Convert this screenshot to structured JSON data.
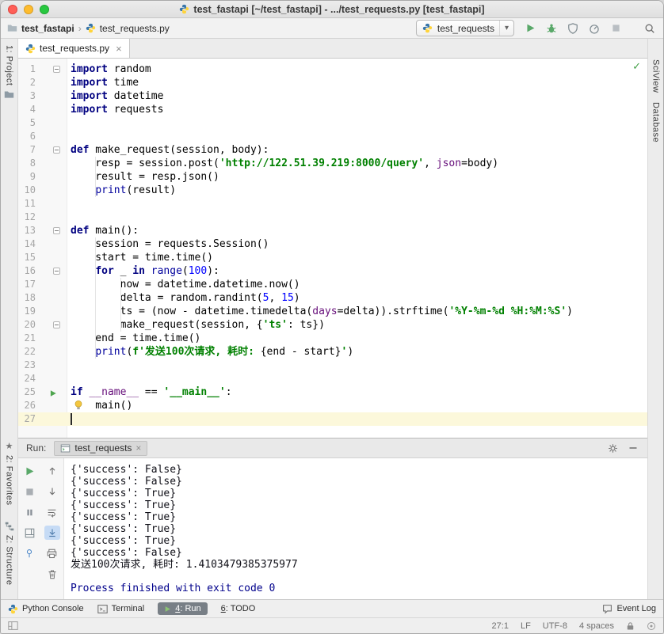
{
  "titlebar": {
    "title": "test_fastapi [~/test_fastapi] - .../test_requests.py [test_fastapi]"
  },
  "icons": {
    "chevron": "›",
    "combo_arrow": "▾",
    "close": "×",
    "check": "✓",
    "star": "★"
  },
  "colors": {
    "traffic_close": "#FF5F57",
    "traffic_minimize": "#FEBC2E",
    "traffic_maximize": "#28C840",
    "keyword": "#000080",
    "string": "#008000",
    "number": "#0000FF",
    "builtin": "#00009C",
    "named_argument": "#660E7A",
    "run_green": "#59A869",
    "caret_row": "#FCF8DB"
  },
  "navbar": {
    "breadcrumbs": [
      {
        "label": "test_fastapi"
      },
      {
        "label": "test_requests.py"
      }
    ],
    "run_config": {
      "label": "test_requests"
    },
    "actions": [
      {
        "name": "run-button",
        "icon": "play"
      },
      {
        "name": "debug-button",
        "icon": "bug"
      },
      {
        "name": "coverage-button",
        "icon": "coverage"
      },
      {
        "name": "profiler-button",
        "icon": "profiler"
      },
      {
        "name": "stop-button",
        "icon": "stop"
      },
      {
        "name": "search-everywhere-button",
        "icon": "search",
        "gap": true
      }
    ]
  },
  "stripes": {
    "left_top": [
      {
        "label": "1: Project"
      }
    ],
    "left_bottom": [
      {
        "label": "2: Favorites"
      },
      {
        "label": "Z: Structure"
      }
    ],
    "right": [
      {
        "label": "SciView"
      },
      {
        "label": "Database"
      }
    ]
  },
  "editor": {
    "tab": {
      "label": "test_requests.py"
    },
    "caret_line": 27,
    "run_line": 25,
    "bulb_line": 26,
    "lines": [
      {
        "fold": true,
        "tokens": [
          [
            "kw",
            "import"
          ],
          [
            "pl",
            " random"
          ]
        ]
      },
      {
        "tokens": [
          [
            "kw",
            "import"
          ],
          [
            "pl",
            " time"
          ]
        ]
      },
      {
        "tokens": [
          [
            "kw",
            "import"
          ],
          [
            "pl",
            " datetime"
          ]
        ]
      },
      {
        "tokens": [
          [
            "kw",
            "import"
          ],
          [
            "pl",
            " requests"
          ]
        ]
      },
      {
        "tokens": []
      },
      {
        "tokens": []
      },
      {
        "fold": true,
        "tokens": [
          [
            "kw",
            "def"
          ],
          [
            "pl",
            " make_request(session, body):"
          ]
        ]
      },
      {
        "tokens": [
          [
            "pl",
            "    resp = session.post("
          ],
          [
            "st",
            "'http://122.51.39.219:8000/query'"
          ],
          [
            "pl",
            ", "
          ],
          [
            "kwa",
            "json"
          ],
          [
            "pl",
            "=body)"
          ]
        ]
      },
      {
        "tokens": [
          [
            "pl",
            "    result = resp.json()"
          ]
        ]
      },
      {
        "tokens": [
          [
            "pl",
            "    "
          ],
          [
            "bi",
            "print"
          ],
          [
            "pl",
            "(result)"
          ]
        ]
      },
      {
        "tokens": []
      },
      {
        "tokens": []
      },
      {
        "fold": true,
        "tokens": [
          [
            "kw",
            "def"
          ],
          [
            "pl",
            " main():"
          ]
        ]
      },
      {
        "tokens": [
          [
            "pl",
            "    session = requests.Session()"
          ]
        ]
      },
      {
        "tokens": [
          [
            "pl",
            "    start = time.time()"
          ]
        ]
      },
      {
        "fold": true,
        "tokens": [
          [
            "pl",
            "    "
          ],
          [
            "kw",
            "for"
          ],
          [
            "pl",
            " _ "
          ],
          [
            "kw",
            "in"
          ],
          [
            "pl",
            " "
          ],
          [
            "bi",
            "range"
          ],
          [
            "pl",
            "("
          ],
          [
            "nm",
            "100"
          ],
          [
            "pl",
            "):"
          ]
        ]
      },
      {
        "tokens": [
          [
            "pl",
            "        now = datetime.datetime.now()"
          ]
        ]
      },
      {
        "tokens": [
          [
            "pl",
            "        delta = random.randint("
          ],
          [
            "nm",
            "5"
          ],
          [
            "pl",
            ", "
          ],
          [
            "nm",
            "15"
          ],
          [
            "pl",
            ")"
          ]
        ]
      },
      {
        "tokens": [
          [
            "pl",
            "        ts = (now - datetime.timedelta("
          ],
          [
            "kwa",
            "days"
          ],
          [
            "pl",
            "=delta)).strftime("
          ],
          [
            "st",
            "'%Y-%m-%d %H:%M:%S'"
          ],
          [
            "pl",
            ")"
          ]
        ]
      },
      {
        "fold": true,
        "tokens": [
          [
            "pl",
            "        make_request(session, {"
          ],
          [
            "st",
            "'ts'"
          ],
          [
            "pl",
            ": ts})"
          ]
        ]
      },
      {
        "tokens": [
          [
            "pl",
            "    end = time.time()"
          ]
        ]
      },
      {
        "tokens": [
          [
            "pl",
            "    "
          ],
          [
            "bi",
            "print"
          ],
          [
            "pl",
            "("
          ],
          [
            "st",
            "f'发送100次请求, 耗时: "
          ],
          [
            "pl",
            "{end - start}"
          ],
          [
            "st",
            "'"
          ],
          [
            "pl",
            ")"
          ]
        ]
      },
      {
        "tokens": []
      },
      {
        "tokens": []
      },
      {
        "tokens": [
          [
            "kw",
            "if"
          ],
          [
            "pl",
            " "
          ],
          [
            "du",
            "__name__"
          ],
          [
            "pl",
            " == "
          ],
          [
            "st",
            "'__main__'"
          ],
          [
            "pl",
            ":"
          ]
        ]
      },
      {
        "tokens": [
          [
            "pl",
            "    main()"
          ]
        ]
      },
      {
        "tokens": []
      }
    ]
  },
  "run_panel": {
    "label": "Run:",
    "tab": {
      "label": "test_requests"
    },
    "toolbar_main": [
      {
        "name": "rerun-button",
        "icon": "rerun"
      },
      {
        "name": "stop-process-button",
        "icon": "stopgray"
      },
      {
        "name": "pause-output-button",
        "icon": "pause"
      },
      {
        "name": "restore-layout-button",
        "icon": "layout"
      },
      {
        "name": "pin-tab-button",
        "icon": "pin"
      }
    ],
    "toolbar_console": [
      {
        "name": "up-stack-trace-button",
        "icon": "up"
      },
      {
        "name": "down-stack-trace-button",
        "icon": "down"
      },
      {
        "name": "soft-wrap-button",
        "icon": "softwrap"
      },
      {
        "name": "scroll-to-end-button",
        "icon": "scrollend",
        "selected": true
      },
      {
        "name": "print-console-button",
        "icon": "print"
      },
      {
        "name": "clear-all-button",
        "icon": "trash"
      }
    ],
    "console": [
      {
        "type": "stdout",
        "text": "{'success': False}"
      },
      {
        "type": "stdout",
        "text": "{'success': False}"
      },
      {
        "type": "stdout",
        "text": "{'success': True}"
      },
      {
        "type": "stdout",
        "text": "{'success': True}"
      },
      {
        "type": "stdout",
        "text": "{'success': True}"
      },
      {
        "type": "stdout",
        "text": "{'success': True}"
      },
      {
        "type": "stdout",
        "text": "{'success': True}"
      },
      {
        "type": "stdout",
        "text": "{'success': False}"
      },
      {
        "type": "stdout",
        "text": "发送100次请求, 耗时: 1.4103479385375977"
      },
      {
        "type": "stdout",
        "text": ""
      },
      {
        "type": "system",
        "text": "Process finished with exit code 0"
      }
    ]
  },
  "tool_buttons": {
    "left": [
      {
        "name": "toolwindow-python-console",
        "icon": "pyfile",
        "label": "Python Console"
      },
      {
        "name": "toolwindow-terminal",
        "icon": "terminal",
        "label": "Terminal"
      },
      {
        "name": "toolwindow-run",
        "icon": "runplay",
        "label_mnemonic": "4",
        "label_rest": ": Run",
        "selected": true
      },
      {
        "name": "toolwindow-todo",
        "label_mnemonic": "6",
        "label_rest": ": TODO"
      }
    ],
    "right": [
      {
        "name": "event-log-button",
        "icon": "eventlog",
        "label": "Event Log"
      }
    ]
  },
  "statusbar": {
    "items": [
      "27:1",
      "LF",
      "UTF-8",
      "4 spaces"
    ]
  }
}
